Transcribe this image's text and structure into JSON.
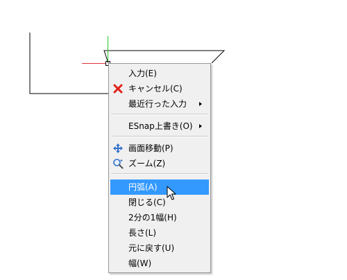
{
  "menu": {
    "items": [
      {
        "label": "入力(E)",
        "icon": "",
        "submenu": false,
        "highlighted": false
      },
      {
        "label": "キャンセル(C)",
        "icon": "red-x-cancel-icon",
        "submenu": false,
        "highlighted": false
      },
      {
        "label": "最近行った入力",
        "icon": "",
        "submenu": true,
        "highlighted": false
      },
      {
        "label": "ESnap上書き(O)",
        "icon": "",
        "submenu": true,
        "highlighted": false
      },
      {
        "label": "画面移動(P)",
        "icon": "pan-arrows-icon",
        "submenu": false,
        "highlighted": false
      },
      {
        "label": "ズーム(Z)",
        "icon": "zoom-magnifier-icon",
        "submenu": false,
        "highlighted": false
      },
      {
        "label": "円弧(A)",
        "icon": "",
        "submenu": false,
        "highlighted": true
      },
      {
        "label": "閉じる(C)",
        "icon": "",
        "submenu": false,
        "highlighted": false
      },
      {
        "label": "2分の1幅(H)",
        "icon": "",
        "submenu": false,
        "highlighted": false
      },
      {
        "label": "長さ(L)",
        "icon": "",
        "submenu": false,
        "highlighted": false
      },
      {
        "label": "元に戻す(U)",
        "icon": "",
        "submenu": false,
        "highlighted": false
      },
      {
        "label": "幅(W)",
        "icon": "",
        "submenu": false,
        "highlighted": false
      }
    ]
  },
  "colors": {
    "menu_background": "#f0f0f0",
    "highlight": "#3399ff",
    "cancel_icon": "#e0211a",
    "crosshair_x": "#e0303a",
    "crosshair_y": "#25c525",
    "pan_icon": "#2e6fc9"
  }
}
